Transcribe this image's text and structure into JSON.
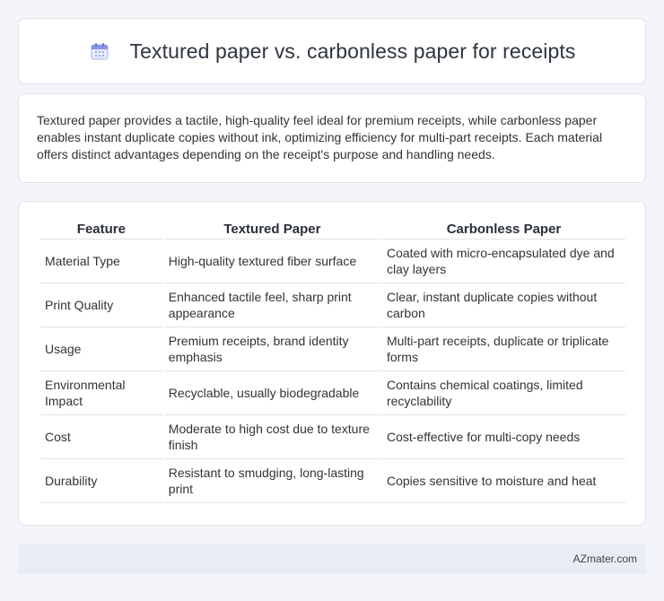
{
  "header": {
    "icon": "calendar-icon",
    "title": "Textured paper vs. carbonless paper for receipts"
  },
  "intro": {
    "text": "Textured paper provides a tactile, high-quality feel ideal for premium receipts, while carbonless paper enables instant duplicate copies without ink, optimizing efficiency for multi-part receipts. Each material offers distinct advantages depending on the receipt's purpose and handling needs."
  },
  "table": {
    "columns": [
      "Feature",
      "Textured Paper",
      "Carbonless Paper"
    ],
    "rows": [
      [
        "Material Type",
        "High-quality textured fiber surface",
        "Coated with micro-encapsulated dye and clay layers"
      ],
      [
        "Print Quality",
        "Enhanced tactile feel, sharp print appearance",
        "Clear, instant duplicate copies without carbon"
      ],
      [
        "Usage",
        "Premium receipts, brand identity emphasis",
        "Multi-part receipts, duplicate or triplicate forms"
      ],
      [
        "Environmental Impact",
        "Recyclable, usually biodegradable",
        "Contains chemical coatings, limited recyclability"
      ],
      [
        "Cost",
        "Moderate to high cost due to texture finish",
        "Cost-effective for multi-copy needs"
      ],
      [
        "Durability",
        "Resistant to smudging, long-lasting print",
        "Copies sensitive to moisture and heat"
      ]
    ]
  },
  "footer": {
    "text": "AZmater.com"
  },
  "colors": {
    "background": "#f3f5f9",
    "card": "#ffffff",
    "footer": "#e8edf5",
    "icon_accent": "#7b84e8"
  }
}
